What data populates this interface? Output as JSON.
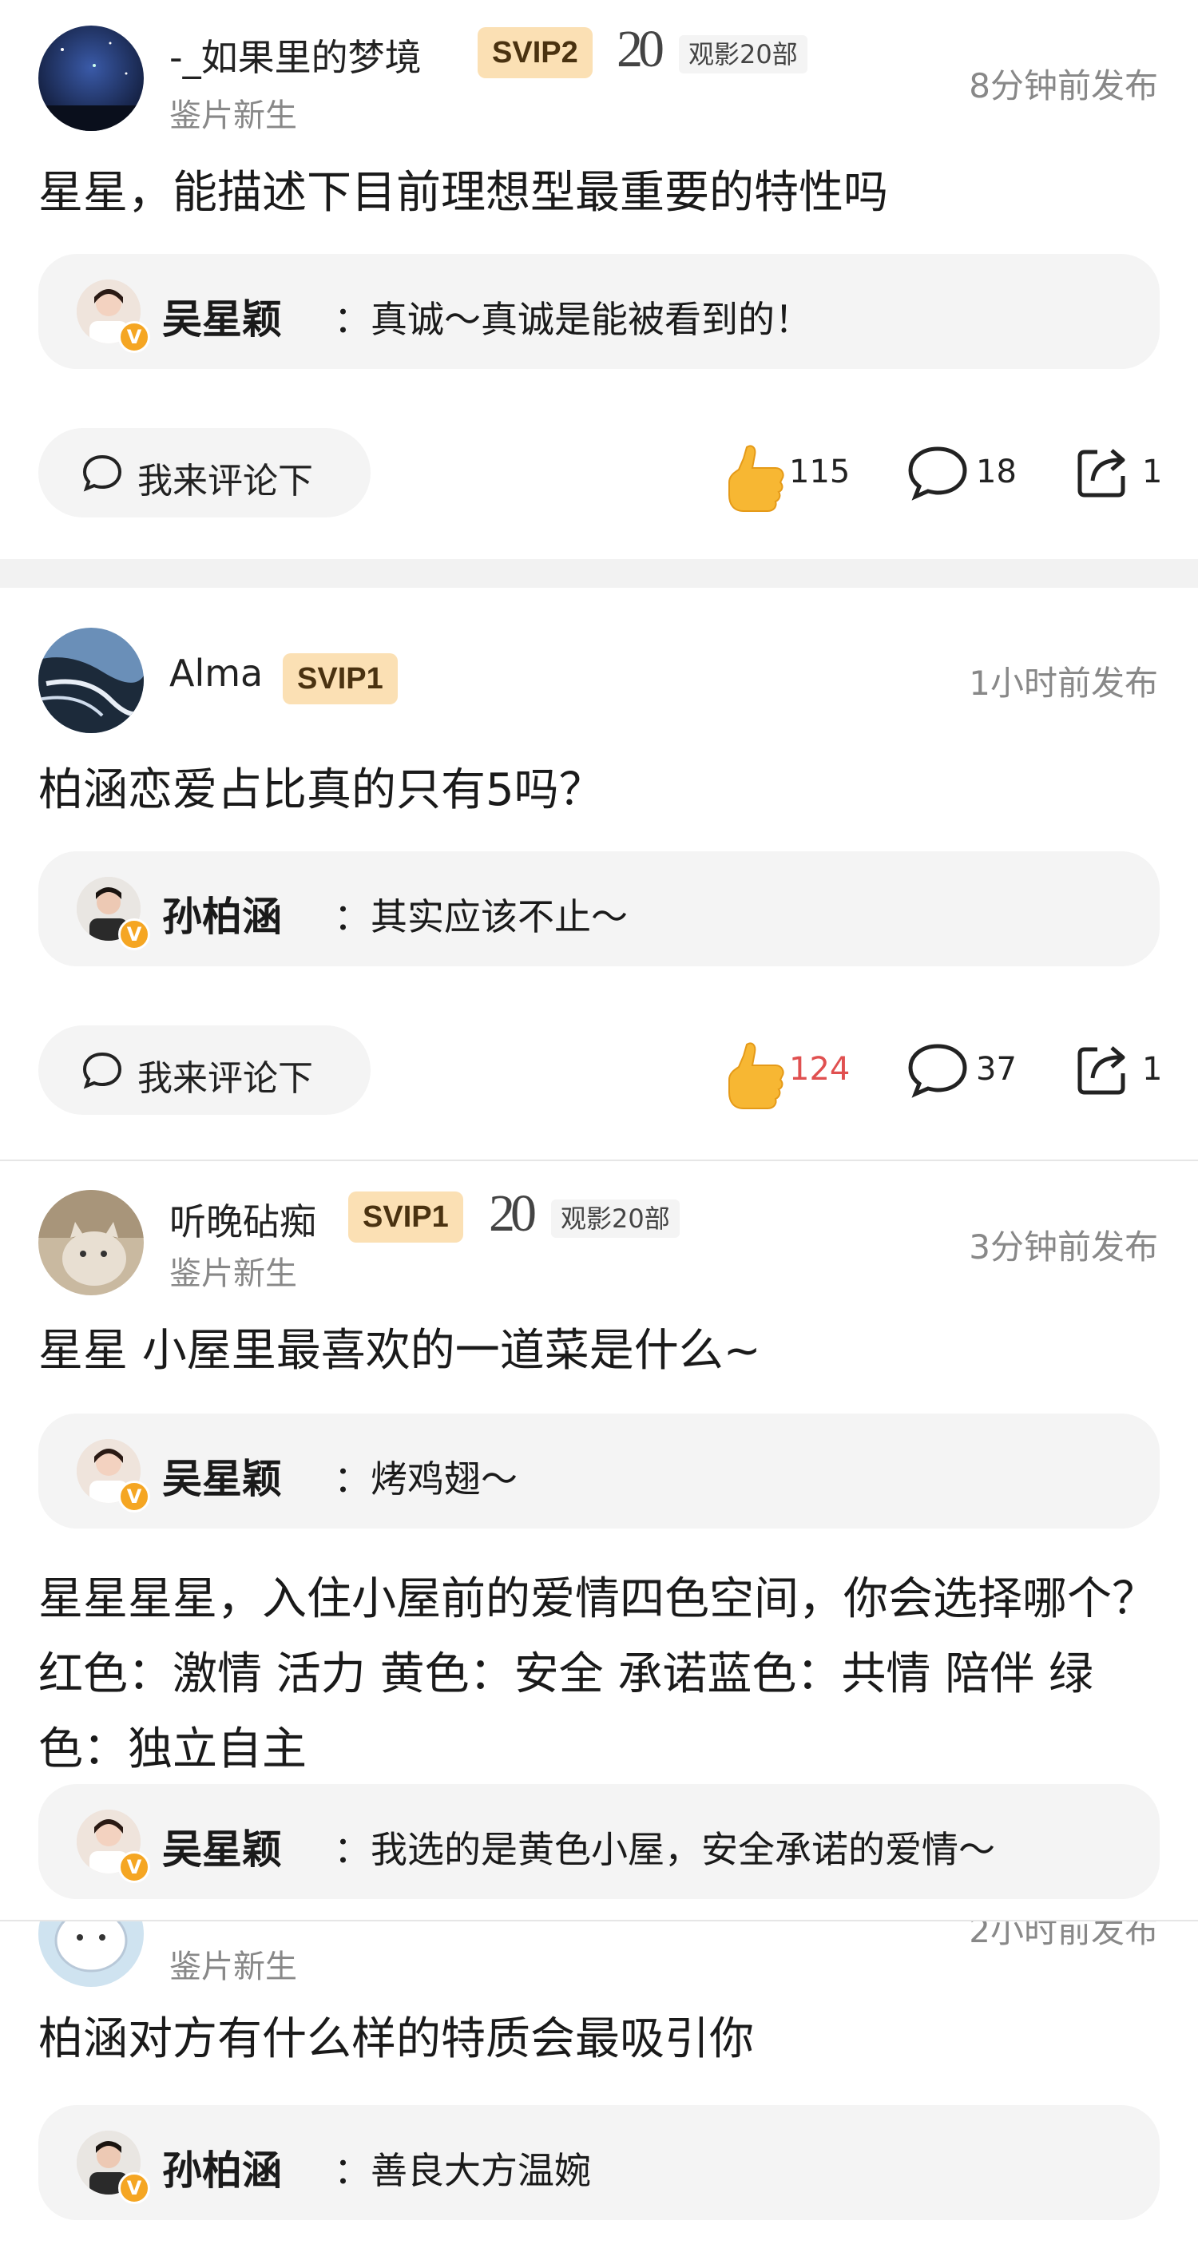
{
  "posts": [
    {
      "username": "-_如果里的梦境",
      "vip": "SVIP2",
      "badge_num": "20",
      "badge_text": "观影20部",
      "subtitle": "鉴片新生",
      "time": "8分钟前发布",
      "question": "星星，能描述下目前理想型最重要的特性吗",
      "reply": {
        "name": "吴星颖",
        "text": "：真诚～真诚是能被看到的！"
      },
      "comment_label": "我来评论下",
      "likes": "115",
      "comments": "18",
      "shares": "1"
    },
    {
      "username": "Alma",
      "vip": "SVIP1",
      "time": "1小时前发布",
      "question": "柏涵恋爱占比真的只有5吗？",
      "reply": {
        "name": "孙柏涵",
        "text": "：其实应该不止～"
      },
      "comment_label": "我来评论下",
      "likes": "124",
      "comments": "37",
      "shares": "1"
    },
    {
      "username": "听晚砧痴",
      "vip": "SVIP1",
      "badge_num": "20",
      "badge_text": "观影20部",
      "subtitle": "鉴片新生",
      "time": "3分钟前发布",
      "question": "星星 小屋里最喜欢的一道菜是什么~",
      "reply": {
        "name": "吴星颖",
        "text": "：烤鸡翅～"
      },
      "question2": "星星星星，入住小屋前的爱情四色空间，你会选择哪个？红色：激情 活力 黄色：安全 承诺蓝色：共情 陪伴 绿色：独立自主",
      "reply2": {
        "name": "吴星颖",
        "text": "：我选的是黄色小屋，安全承诺的爱情～"
      }
    },
    {
      "subtitle": "鉴片新生",
      "time": "2小时前发布",
      "question": "柏涵对方有什么样的特质会最吸引你",
      "reply": {
        "name": "孙柏涵",
        "text": "：善良大方温婉"
      }
    }
  ],
  "colors": {
    "vip_bg": "#fbe0b4",
    "reply_bg": "#f4f4f4",
    "like_icon": "#f7b733",
    "liked_count": "#e05050"
  }
}
